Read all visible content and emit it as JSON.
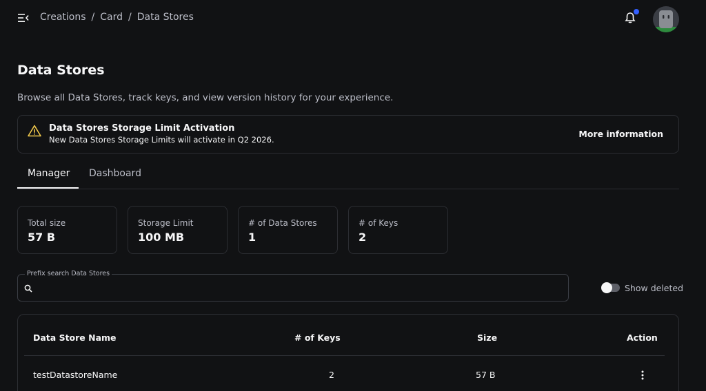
{
  "header": {
    "breadcrumb": [
      "Creations",
      "Card",
      "Data Stores"
    ],
    "breadcrumb_separator": "/"
  },
  "page": {
    "title": "Data Stores",
    "description": "Browse all Data Stores, track keys, and view version history for your experience."
  },
  "banner": {
    "title": "Data Stores Storage Limit Activation",
    "message": "New Data Stores Storage Limits will activate in Q2 2026.",
    "link_label": "More information",
    "icon": "warning-icon",
    "icon_color": "#f2c94c"
  },
  "tabs": [
    {
      "label": "Manager",
      "active": true
    },
    {
      "label": "Dashboard",
      "active": false
    }
  ],
  "stats": [
    {
      "label": "Total size",
      "value": "57 B"
    },
    {
      "label": "Storage Limit",
      "value": "100 MB"
    },
    {
      "label": "# of Data Stores",
      "value": "1"
    },
    {
      "label": "# of Keys",
      "value": "2"
    }
  ],
  "search": {
    "label": "Prefix search Data Stores",
    "value": "",
    "placeholder": ""
  },
  "show_deleted": {
    "label": "Show deleted",
    "enabled": false
  },
  "table": {
    "columns": [
      "Data Store Name",
      "# of Keys",
      "Size",
      "Action"
    ],
    "rows": [
      {
        "name": "testDatastoreName",
        "keys": "2",
        "size": "57 B"
      }
    ]
  },
  "colors": {
    "background": "#111214",
    "border": "#2c2e33",
    "notification_dot": "#335fff"
  }
}
